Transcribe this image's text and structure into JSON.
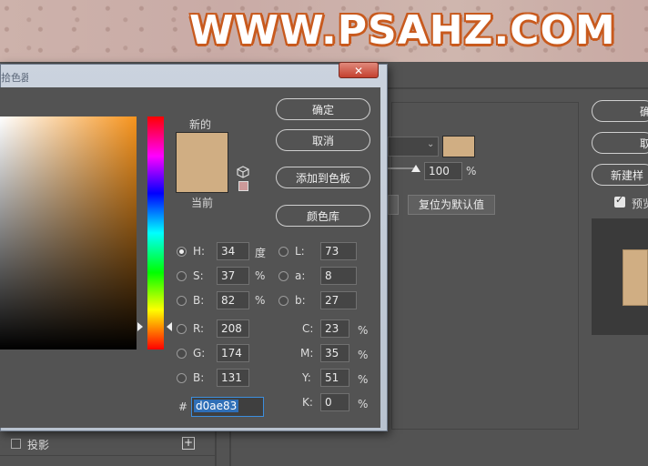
{
  "watermark": {
    "text": "WWW.PSAHZ.COM"
  },
  "background_window": {
    "opacity_value": "100",
    "opacity_unit": "%",
    "swatch_color": "#d0ae83",
    "reset_default_label": "复位为默认值",
    "right_buttons": {
      "ok_partial": "确",
      "cancel_partial": "取",
      "new_style_partial": "新建样",
      "preview_partial": "预览"
    },
    "drop_shadow_label": "投影",
    "add_icon": "plus-icon"
  },
  "dialog": {
    "title_fragment": "拾色器",
    "close_symbol": "✕",
    "new_label": "新的",
    "current_label": "当前",
    "new_color": "#d0ae83",
    "current_color": "#d0ae83",
    "buttons": {
      "ok": "确定",
      "cancel": "取消",
      "add_to_swatches": "添加到色板",
      "color_libraries": "颜色库"
    },
    "fields": {
      "H": {
        "label": "H:",
        "value": "34",
        "unit": "度"
      },
      "S": {
        "label": "S:",
        "value": "37",
        "unit": "%"
      },
      "B": {
        "label": "B:",
        "value": "82",
        "unit": "%"
      },
      "R": {
        "label": "R:",
        "value": "208"
      },
      "G": {
        "label": "G:",
        "value": "174"
      },
      "Bl": {
        "label": "B:",
        "value": "131"
      },
      "L": {
        "label": "L:",
        "value": "73"
      },
      "a": {
        "label": "a:",
        "value": "8"
      },
      "b": {
        "label": "b:",
        "value": "27"
      },
      "C": {
        "label": "C:",
        "value": "23",
        "unit": "%"
      },
      "M": {
        "label": "M:",
        "value": "35",
        "unit": "%"
      },
      "Y": {
        "label": "Y:",
        "value": "51",
        "unit": "%"
      },
      "K": {
        "label": "K:",
        "value": "0",
        "unit": "%"
      }
    },
    "hex": {
      "label": "#",
      "value": "d0ae83"
    },
    "icons": {
      "cube": "cube-icon",
      "websafe": "websafe-swatch-icon"
    }
  }
}
